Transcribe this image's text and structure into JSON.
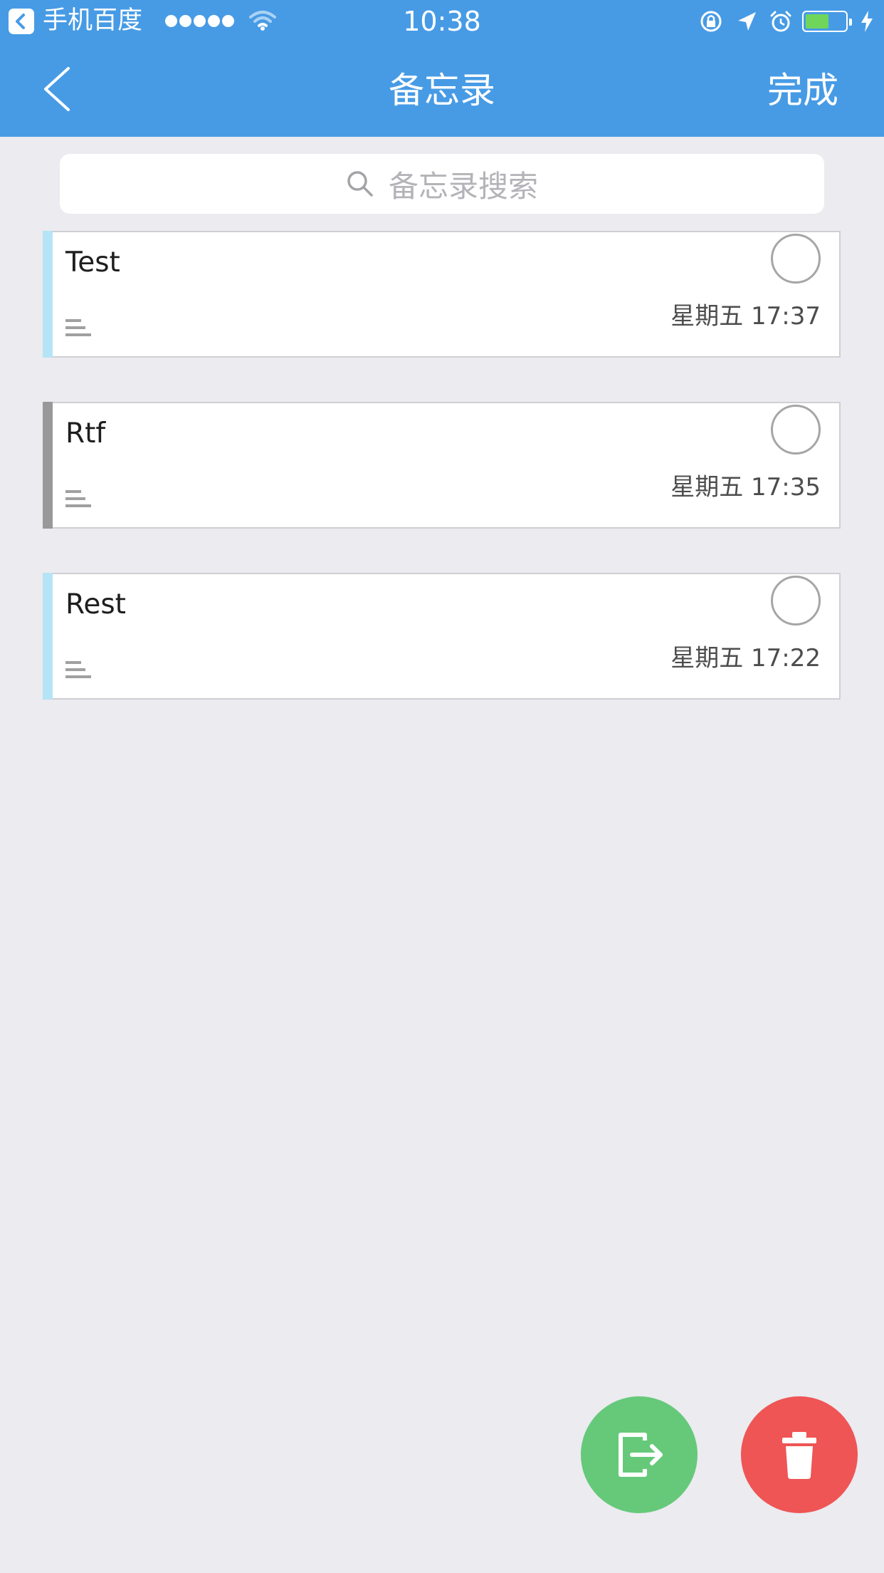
{
  "status_bar": {
    "app_name": "手机百度",
    "time": "10:38",
    "battery_percent": 60,
    "signal_bars": 5
  },
  "nav": {
    "title": "备忘录",
    "done_label": "完成",
    "back_icon": "chevron-left-icon"
  },
  "search": {
    "placeholder": "备忘录搜索",
    "icon": "search-icon"
  },
  "notes": [
    {
      "title": "Test",
      "date": "星期五 17:37",
      "accent": "#b5e4f6",
      "selected": false
    },
    {
      "title": "Rtf",
      "date": "星期五 17:35",
      "accent": "#999999",
      "selected": false
    },
    {
      "title": "Rest",
      "date": "星期五 17:22",
      "accent": "#b5e4f6",
      "selected": false
    }
  ],
  "actions": {
    "export_icon": "export-icon",
    "export_color": "#66c97a",
    "delete_icon": "trash-icon",
    "delete_color": "#ee5554"
  },
  "colors": {
    "header": "#479be5",
    "background": "#ebebf0"
  }
}
